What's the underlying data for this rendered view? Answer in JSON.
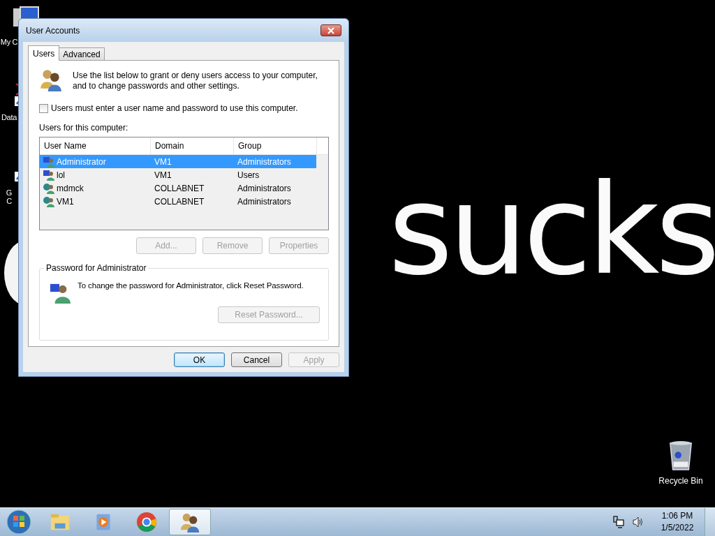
{
  "desktop": {
    "wallpaper_text": "sucks",
    "icons": [
      {
        "kind": "computer",
        "lines": [
          "My C"
        ]
      },
      {
        "kind": "database",
        "lines": [
          "Data"
        ]
      },
      {
        "kind": "app",
        "lines": [
          "G",
          "C"
        ]
      }
    ],
    "recycle_bin": {
      "label": "Recycle Bin"
    }
  },
  "window": {
    "title": "User Accounts",
    "tabs": [
      {
        "label": "Users",
        "selected": true
      },
      {
        "label": "Advanced",
        "selected": false
      }
    ],
    "intro": "Use the list below to grant or deny users access to your computer, and to change passwords and other settings.",
    "checkbox": {
      "label": "Users must enter a user name and password to use this computer.",
      "checked": false
    },
    "list_label": "Users for this computer:",
    "table": {
      "columns": [
        "User Name",
        "Domain",
        "Group"
      ],
      "rows": [
        {
          "kind": "local",
          "user": "Administrator",
          "domain": "VM1",
          "group": "Administrators",
          "selected": true
        },
        {
          "kind": "local",
          "user": "lol",
          "domain": "VM1",
          "group": "Users",
          "selected": false
        },
        {
          "kind": "domain",
          "user": "mdmck",
          "domain": "COLLABNET",
          "group": "Administrators",
          "selected": false
        },
        {
          "kind": "domain",
          "user": "VM1",
          "domain": "COLLABNET",
          "group": "Administrators",
          "selected": false
        }
      ]
    },
    "list_buttons": [
      {
        "label": "Add...",
        "disabled": true
      },
      {
        "label": "Remove",
        "disabled": true
      },
      {
        "label": "Properties",
        "disabled": true
      }
    ],
    "password": {
      "title": "Password for Administrator",
      "text": "To change the password for Administrator, click Reset Password.",
      "button": {
        "label": "Reset Password...",
        "disabled": true
      }
    },
    "footer_buttons": [
      {
        "label": "OK",
        "disabled": false,
        "default": true
      },
      {
        "label": "Cancel",
        "disabled": false,
        "default": false
      },
      {
        "label": "Apply",
        "disabled": true,
        "default": false
      }
    ]
  },
  "taskbar": {
    "apps": [
      {
        "kind": "explorer",
        "active": false
      },
      {
        "kind": "media",
        "active": false
      },
      {
        "kind": "browser",
        "active": false
      },
      {
        "kind": "accounts",
        "active": true
      }
    ],
    "time": "1:06 PM",
    "date": "1/5/2022"
  }
}
